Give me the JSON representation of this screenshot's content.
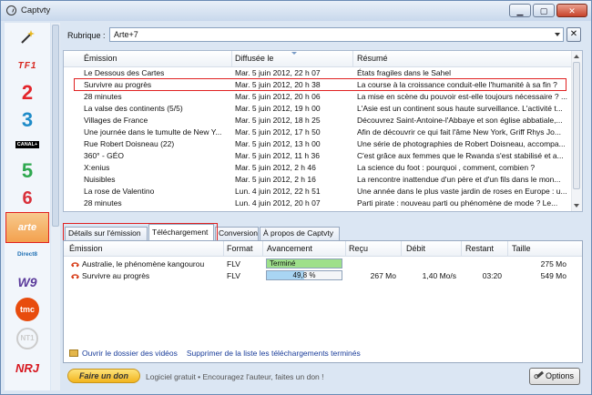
{
  "window": {
    "title": "Captvty"
  },
  "channels": [
    {
      "name": "wand",
      "label": ""
    },
    {
      "name": "tf1",
      "label": "TF1",
      "color": "#d7271f"
    },
    {
      "name": "france2",
      "label": "2",
      "color": "#e3252b"
    },
    {
      "name": "france3",
      "label": "3",
      "color": "#1e8bc8"
    },
    {
      "name": "canalplus",
      "label": "CANAL+",
      "color": "#000000"
    },
    {
      "name": "france5",
      "label": "5",
      "color": "#2fa84f"
    },
    {
      "name": "m6",
      "label": "6",
      "color": "#d9303a"
    },
    {
      "name": "arte",
      "label": "arte",
      "color": "#ffffff"
    },
    {
      "name": "direct8",
      "label": "Direct8",
      "color": "#1e6fb3"
    },
    {
      "name": "w9",
      "label": "W9",
      "color": "#5b3b9b"
    },
    {
      "name": "tmc",
      "label": "tmc",
      "color": "#e84c0e"
    },
    {
      "name": "nt1",
      "label": "NT1",
      "color": "#c0c0c0"
    },
    {
      "name": "nrj12",
      "label": "NRJ",
      "color": "#d7171f"
    }
  ],
  "rubrique": {
    "label": "Rubrique :",
    "value": "Arte+7",
    "clear": "✕"
  },
  "grid": {
    "columns": [
      "Émission",
      "Diffusée le",
      "Résumé"
    ],
    "rows": [
      [
        "Le Dessous des Cartes",
        "Mar. 5 juin 2012, 22 h 07",
        "États fragiles dans le Sahel"
      ],
      [
        "Survivre au progrès",
        "Mar. 5 juin 2012, 20 h 38",
        "La course à la croissance conduit-elle l'humanité à sa fin ?"
      ],
      [
        "28 minutes",
        "Mar. 5 juin 2012, 20 h 06",
        "La mise en scène du pouvoir est-elle toujours nécessaire ? ..."
      ],
      [
        "La valse des continents (5/5)",
        "Mar. 5 juin 2012, 19 h 00",
        "L'Asie est un continent sous haute surveillance. L'activité t..."
      ],
      [
        "Villages de France",
        "Mar. 5 juin 2012, 18 h 25",
        "Découvrez Saint-Antoine-l'Abbaye et son église abbatiale,..."
      ],
      [
        "Une journée dans le tumulte de New Y...",
        "Mar. 5 juin 2012, 17 h 50",
        "Afin de découvrir ce qui fait l'âme New York, Griff Rhys Jo..."
      ],
      [
        "Rue Robert Doisneau (22)",
        "Mar. 5 juin 2012, 13 h 00",
        "Une série de photographies de Robert Doisneau, accompa..."
      ],
      [
        "360° - GÉO",
        "Mar. 5 juin 2012, 11 h 36",
        "C'est grâce aux femmes que le Rwanda s'est stabilisé et a..."
      ],
      [
        "X:enius",
        "Mar. 5 juin 2012, 2 h 46",
        "La science du foot : pourquoi , comment, combien ?"
      ],
      [
        "Nuisibles",
        "Mar. 5 juin 2012, 2 h 16",
        "La rencontre inattendue d'un père et d'un fils dans le mon..."
      ],
      [
        "La rose de Valentino",
        "Lun. 4 juin 2012, 22 h 51",
        "Une année dans le plus vaste jardin de roses en Europe : u..."
      ],
      [
        "28 minutes",
        "Lun. 4 juin 2012, 20 h 07",
        "Parti pirate : nouveau parti ou phénomène de mode ? Le..."
      ]
    ]
  },
  "tabs": [
    {
      "label": "Détails sur l'émission"
    },
    {
      "label": "Téléchargement"
    },
    {
      "label": "Conversion"
    },
    {
      "label": "À propos de Captvty"
    }
  ],
  "downloads": {
    "columns": [
      "Émission",
      "Format",
      "Avancement",
      "Reçu",
      "Débit",
      "Restant",
      "Taille"
    ],
    "rows": [
      {
        "name": "Australie, le phénomène kangourou",
        "format": "FLV",
        "progress_text": "Terminé",
        "progress": 1.0,
        "status_color": "#9ee08a",
        "recu": "",
        "debit": "",
        "restant": "",
        "taille": "275 Mo"
      },
      {
        "name": "Survivre au progrès",
        "format": "FLV",
        "progress_text": "49,8 %",
        "progress": 0.498,
        "status_color": "#a9d5f3",
        "recu": "267 Mo",
        "debit": "1,40 Mo/s",
        "restant": "03:20",
        "taille": "549 Mo"
      }
    ],
    "open_folder": "Ouvrir le dossier des vidéos",
    "remove_finished": "Supprimer de la liste les téléchargements terminés"
  },
  "footer": {
    "donate": "Faire un don",
    "text": "Logiciel gratuit  •  Encouragez l'auteur, faites un don !",
    "options": "Options"
  }
}
